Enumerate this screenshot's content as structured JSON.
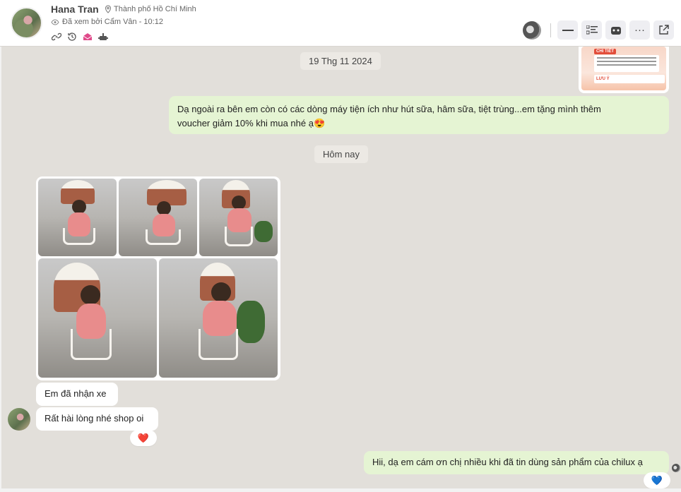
{
  "contact": {
    "name": "Hana Tran",
    "location": "Thành phố Hồ Chí Minh",
    "seen_status": "Đã xem bởi Cẩm Vân - 10:12"
  },
  "header_icons": [
    "link-icon",
    "history-icon",
    "mail-icon",
    "bot-icon"
  ],
  "toolbar": {
    "buttons": [
      "minimize-icon",
      "list-icon",
      "cast-icon",
      "more-icon",
      "external-link-icon"
    ],
    "more_label": "···"
  },
  "chat": {
    "date_1": "19 Thg 11 2024",
    "date_2": "Hôm nay",
    "card": {
      "tag": "CHI TIẾT",
      "note": "LƯU Ý"
    },
    "msg_out_1_line1": "Dạ ngoài ra bên em còn có các dòng máy tiện ích như hút sữa, hâm sữa, tiệt trùng...em tặng mình thêm",
    "msg_out_1_line2": "voucher giảm 10% khi mua nhé ạ",
    "msg_out_1_emoji": "😍",
    "msg_in_1": "Em đã nhận xe",
    "msg_in_2": "Rất hài lòng nhé shop oi",
    "reaction_in": "❤️",
    "msg_out_2": "Hii, dạ em cám ơn chị nhiều khi đã tin dùng sản phẩm của chilux ạ",
    "reaction_out": "💙"
  },
  "photos_count": 5
}
